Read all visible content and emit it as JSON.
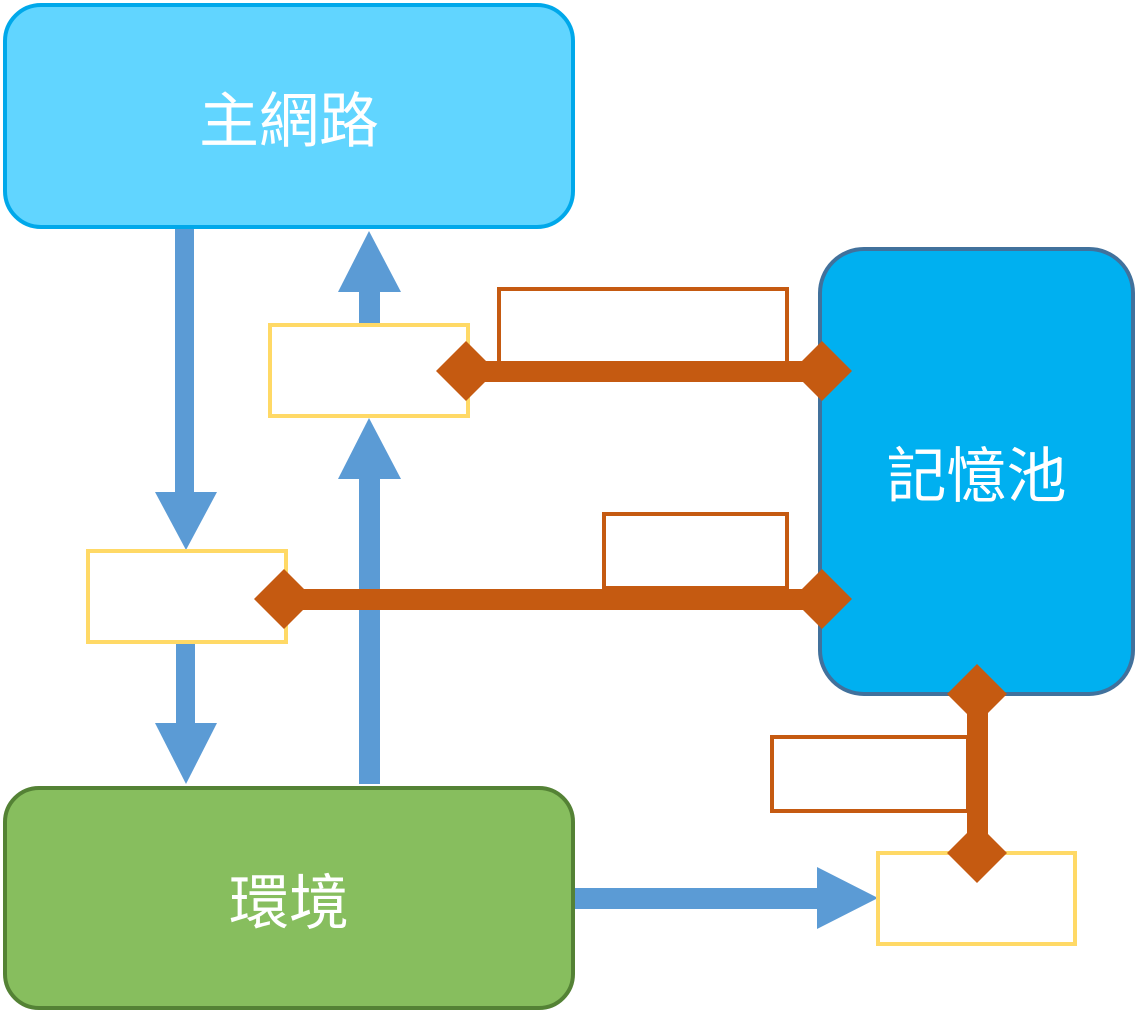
{
  "nodes": {
    "main_network": {
      "label": "主網路",
      "fill": "#61D5FF",
      "stroke": "#00A8EA"
    },
    "memory_pool": {
      "label": "記憶池",
      "fill": "#00B0F0",
      "stroke": "#41719C"
    },
    "environment": {
      "label": "環境",
      "fill": "#87BE5E",
      "stroke": "#548235"
    }
  },
  "colors": {
    "flow_arrow": "#5B9BD5",
    "memory_link": "#C55A11",
    "slot_border": "#FFD966"
  }
}
